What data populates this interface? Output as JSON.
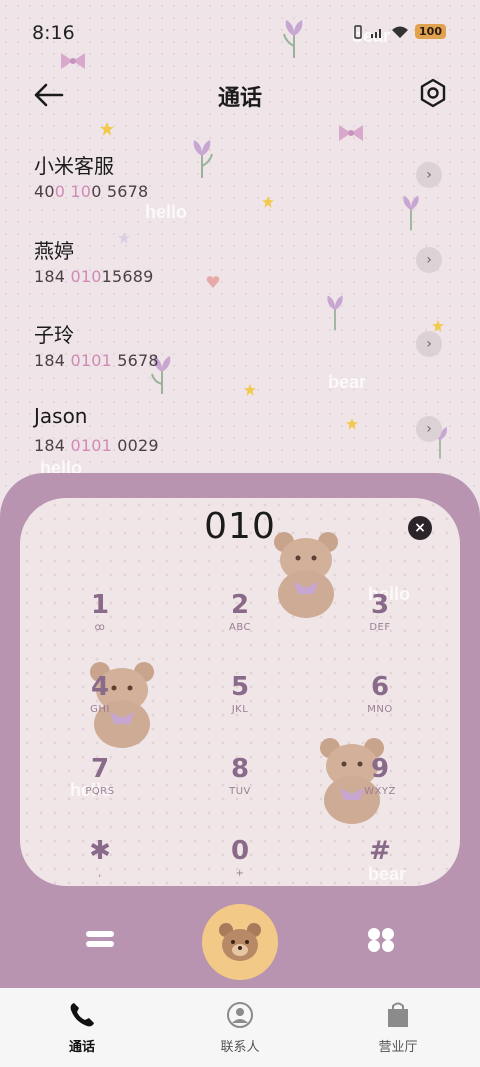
{
  "status_bar": {
    "time": "8:16",
    "battery": "100"
  },
  "header": {
    "title": "通话"
  },
  "contacts": [
    {
      "name": "小米客服",
      "number_parts": [
        "40",
        "0 10",
        "0 5678"
      ]
    },
    {
      "name": "燕婷",
      "number_parts": [
        "184 ",
        "010",
        "15689"
      ]
    },
    {
      "name": "子玲",
      "number_parts": [
        "184 ",
        "0101",
        " 5678"
      ]
    },
    {
      "name": "Jason",
      "number_parts": [
        "184 ",
        "0101",
        " 0029"
      ]
    }
  ],
  "decor_text": {
    "hello": "hello",
    "bear": "bear"
  },
  "dialer": {
    "input": "010",
    "keys": [
      {
        "main": "1",
        "sub": "ꝏ"
      },
      {
        "main": "2",
        "sub": "ABC"
      },
      {
        "main": "3",
        "sub": "DEF"
      },
      {
        "main": "4",
        "sub": "GHI"
      },
      {
        "main": "5",
        "sub": "JKL"
      },
      {
        "main": "6",
        "sub": "MNO"
      },
      {
        "main": "7",
        "sub": "PQRS"
      },
      {
        "main": "8",
        "sub": "TUV"
      },
      {
        "main": "9",
        "sub": "WXYZ"
      },
      {
        "main": "✱",
        "sub": ","
      },
      {
        "main": "0",
        "sub": "+"
      },
      {
        "main": "#",
        "sub": ""
      }
    ]
  },
  "bottom_nav": [
    {
      "label": "通话",
      "icon": "phone-icon"
    },
    {
      "label": "联系人",
      "icon": "person-icon"
    },
    {
      "label": "营业厅",
      "icon": "shopping-bag-icon"
    }
  ],
  "colors": {
    "accent_pink": "#d08ab5",
    "frame_purple": "#b894b0",
    "call_button": "#f3c988",
    "key_purple": "#8a6a8a"
  }
}
